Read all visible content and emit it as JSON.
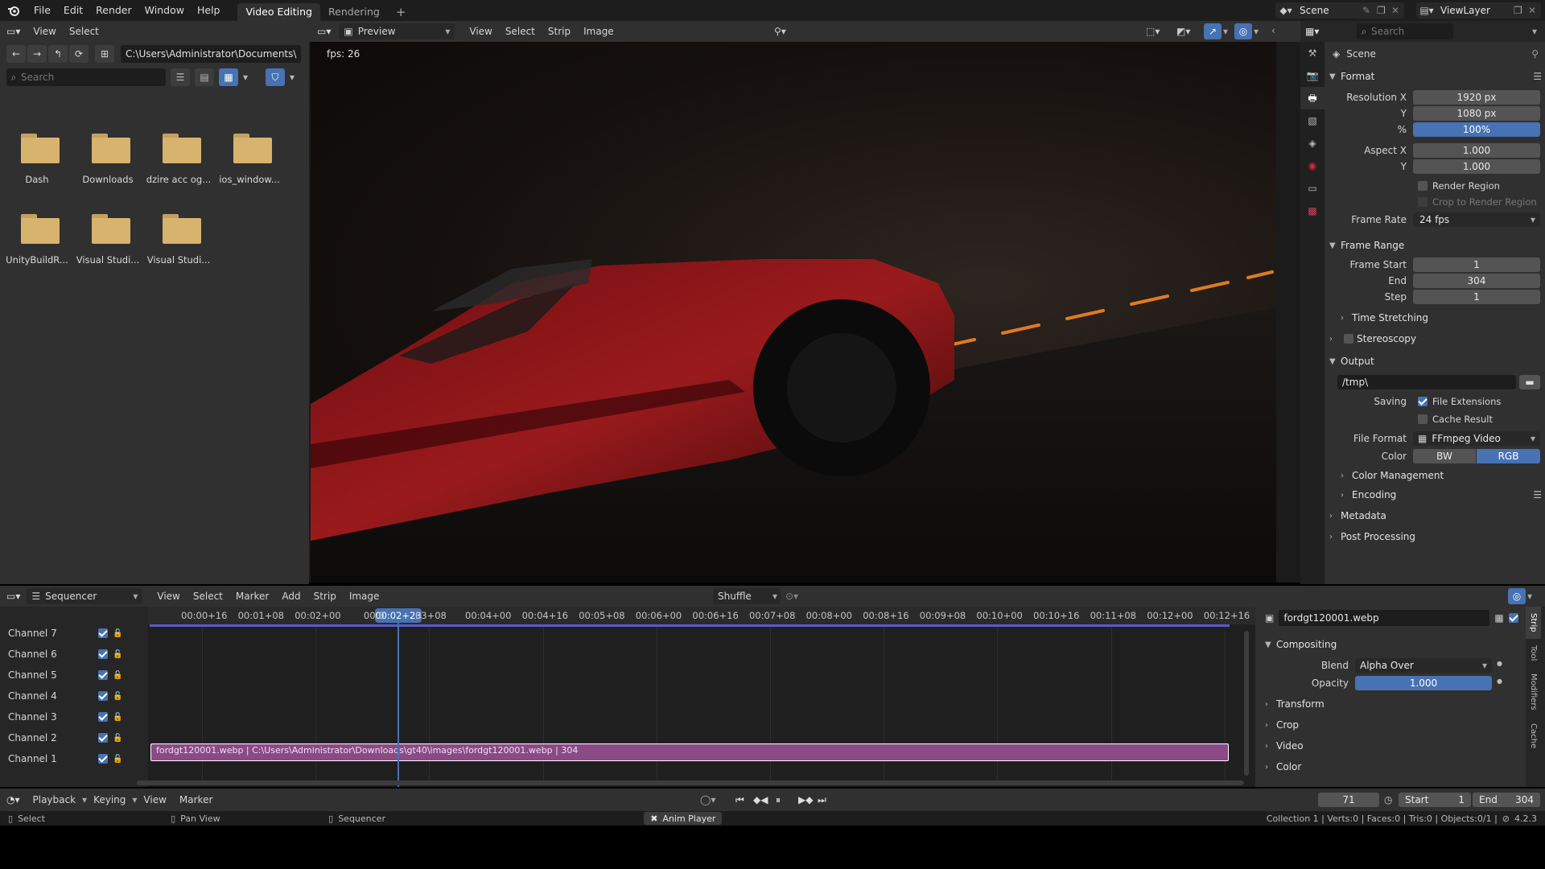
{
  "topbar": {
    "menus": [
      "File",
      "Edit",
      "Render",
      "Window",
      "Help"
    ],
    "workspaces": [
      "Video Editing",
      "Rendering"
    ],
    "add_tab": "+",
    "scene": "Scene",
    "view_layer": "ViewLayer"
  },
  "file_browser": {
    "menus": [
      "View",
      "Select"
    ],
    "path": "C:\\Users\\Administrator\\Documents\\",
    "search_placeholder": "Search",
    "folders": [
      {
        "name": "Dash"
      },
      {
        "name": "Downloads"
      },
      {
        "name": "dzire acc og..."
      },
      {
        "name": "ios_window..."
      },
      {
        "name": "UnityBuildR..."
      },
      {
        "name": "Visual Studi..."
      },
      {
        "name": "Visual Studi..."
      }
    ]
  },
  "preview": {
    "mode": "Preview",
    "menus": [
      "View",
      "Select",
      "Strip",
      "Image"
    ],
    "fps": "fps: 26"
  },
  "properties": {
    "search_placeholder": "Search",
    "scene": "Scene",
    "format": {
      "title": "Format",
      "res_x_label": "Resolution X",
      "res_x": "1920 px",
      "res_y_label": "Y",
      "res_y": "1080 px",
      "pct_label": "%",
      "pct": "100%",
      "aspect_x_label": "Aspect X",
      "aspect_x": "1.000",
      "aspect_y_label": "Y",
      "aspect_y": "1.000",
      "render_region": "Render Region",
      "crop_region": "Crop to Render Region",
      "frame_rate_label": "Frame Rate",
      "frame_rate": "24 fps"
    },
    "frame_range": {
      "title": "Frame Range",
      "start_label": "Frame Start",
      "start": "1",
      "end_label": "End",
      "end": "304",
      "step_label": "Step",
      "step": "1",
      "time_stretching": "Time Stretching"
    },
    "stereoscopy": "Stereoscopy",
    "output": {
      "title": "Output",
      "path": "/tmp\\",
      "saving_label": "Saving",
      "file_ext": "File Extensions",
      "cache_result": "Cache Result",
      "file_format_label": "File Format",
      "file_format": "FFmpeg Video",
      "color_label": "Color",
      "bw": "BW",
      "rgb": "RGB",
      "color_management": "Color Management",
      "encoding": "Encoding"
    },
    "metadata": "Metadata",
    "post_processing": "Post Processing"
  },
  "sequencer": {
    "editor": "Sequencer",
    "menus": [
      "View",
      "Select",
      "Marker",
      "Add",
      "Strip",
      "Image"
    ],
    "overlap_mode": "Shuffle",
    "current_time": "00:02+23",
    "timecodes": [
      "00:00+16",
      "00:01+08",
      "00:02+00",
      "00:0",
      "03+08",
      "00:04+00",
      "00:04+16",
      "00:05+08",
      "00:06+00",
      "00:06+16",
      "00:07+08",
      "00:08+00",
      "00:08+16",
      "00:09+08",
      "00:10+00",
      "00:10+16",
      "00:11+08",
      "00:12+00",
      "00:12+16"
    ],
    "channels": [
      "Channel 7",
      "Channel 6",
      "Channel 5",
      "Channel 4",
      "Channel 3",
      "Channel 2",
      "Channel 1"
    ],
    "strip_label": "fordgt120001.webp | C:\\Users\\Administrator\\Downloads\\gt40\\images\\fordgt120001.webp | 304"
  },
  "strip_panel": {
    "name": "fordgt120001.webp",
    "compositing": "Compositing",
    "blend_label": "Blend",
    "blend": "Alpha Over",
    "opacity_label": "Opacity",
    "opacity": "1.000",
    "sections": [
      "Transform",
      "Crop",
      "Video",
      "Color"
    ],
    "tabs": [
      "Strip",
      "Tool",
      "Modifiers",
      "Cache"
    ]
  },
  "timeline": {
    "menus": [
      "Playback",
      "Keying",
      "View",
      "Marker"
    ],
    "current_frame": "71",
    "start_label": "Start",
    "start": "1",
    "end_label": "End",
    "end": "304"
  },
  "statusbar": {
    "select": "Select",
    "pan_view": "Pan View",
    "sequencer": "Sequencer",
    "anim_player": "Anim Player",
    "stats": "Collection 1 | Verts:0 | Faces:0 | Tris:0 | Objects:0/1 |",
    "version": "4.2.3"
  },
  "colors": {
    "accent": "#4772b3",
    "strip": "#8a4a86",
    "playhead": "#4772b3"
  }
}
